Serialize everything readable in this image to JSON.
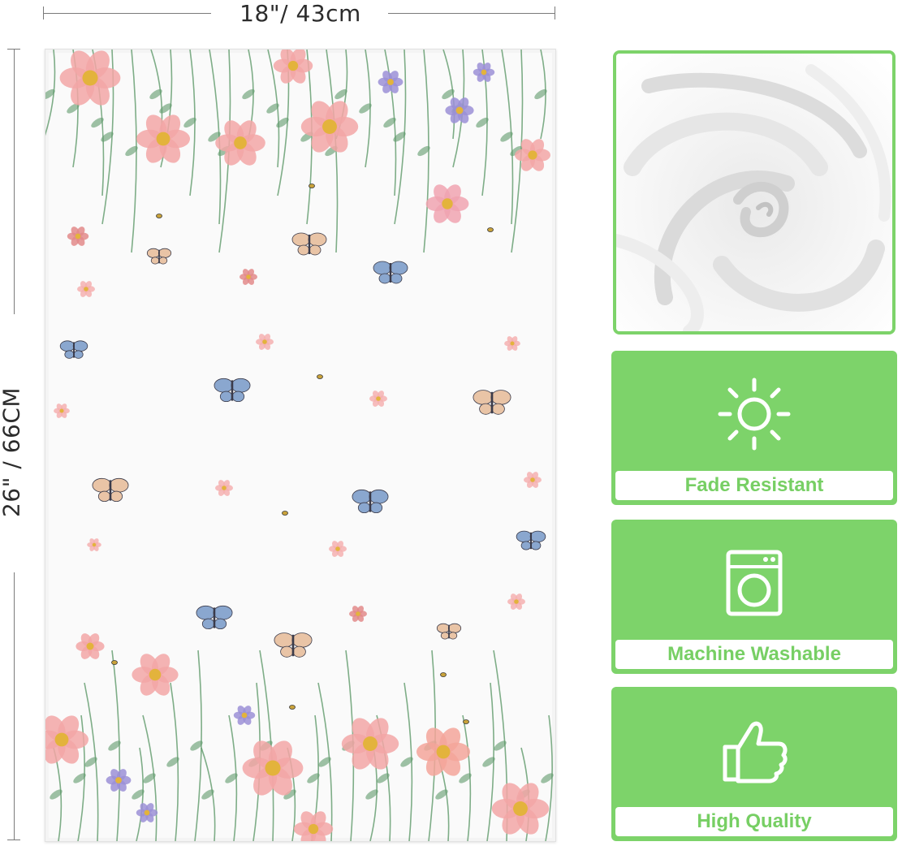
{
  "dimensions": {
    "width_label": "18\"/ 43cm",
    "height_label": "26\" / 66CM"
  },
  "product_image": {
    "icon": "floral-butterfly-towel"
  },
  "fabric_photo": {
    "icon": "white-terry-fabric-swirl"
  },
  "features": [
    {
      "label": "Fade Resistant",
      "icon": "sun-icon"
    },
    {
      "label": "Machine Washable",
      "icon": "washing-machine-icon"
    },
    {
      "label": "High Quality",
      "icon": "thumbs-up-icon"
    }
  ],
  "colors": {
    "accent_green": "#7dd36a",
    "label_text_green": "#77cf64",
    "dimension_text": "#2c2c2c",
    "flower_pink": "#f2a6a6",
    "butterfly_blue": "#8aa7cf",
    "leaf_green": "#5f9a6a"
  }
}
